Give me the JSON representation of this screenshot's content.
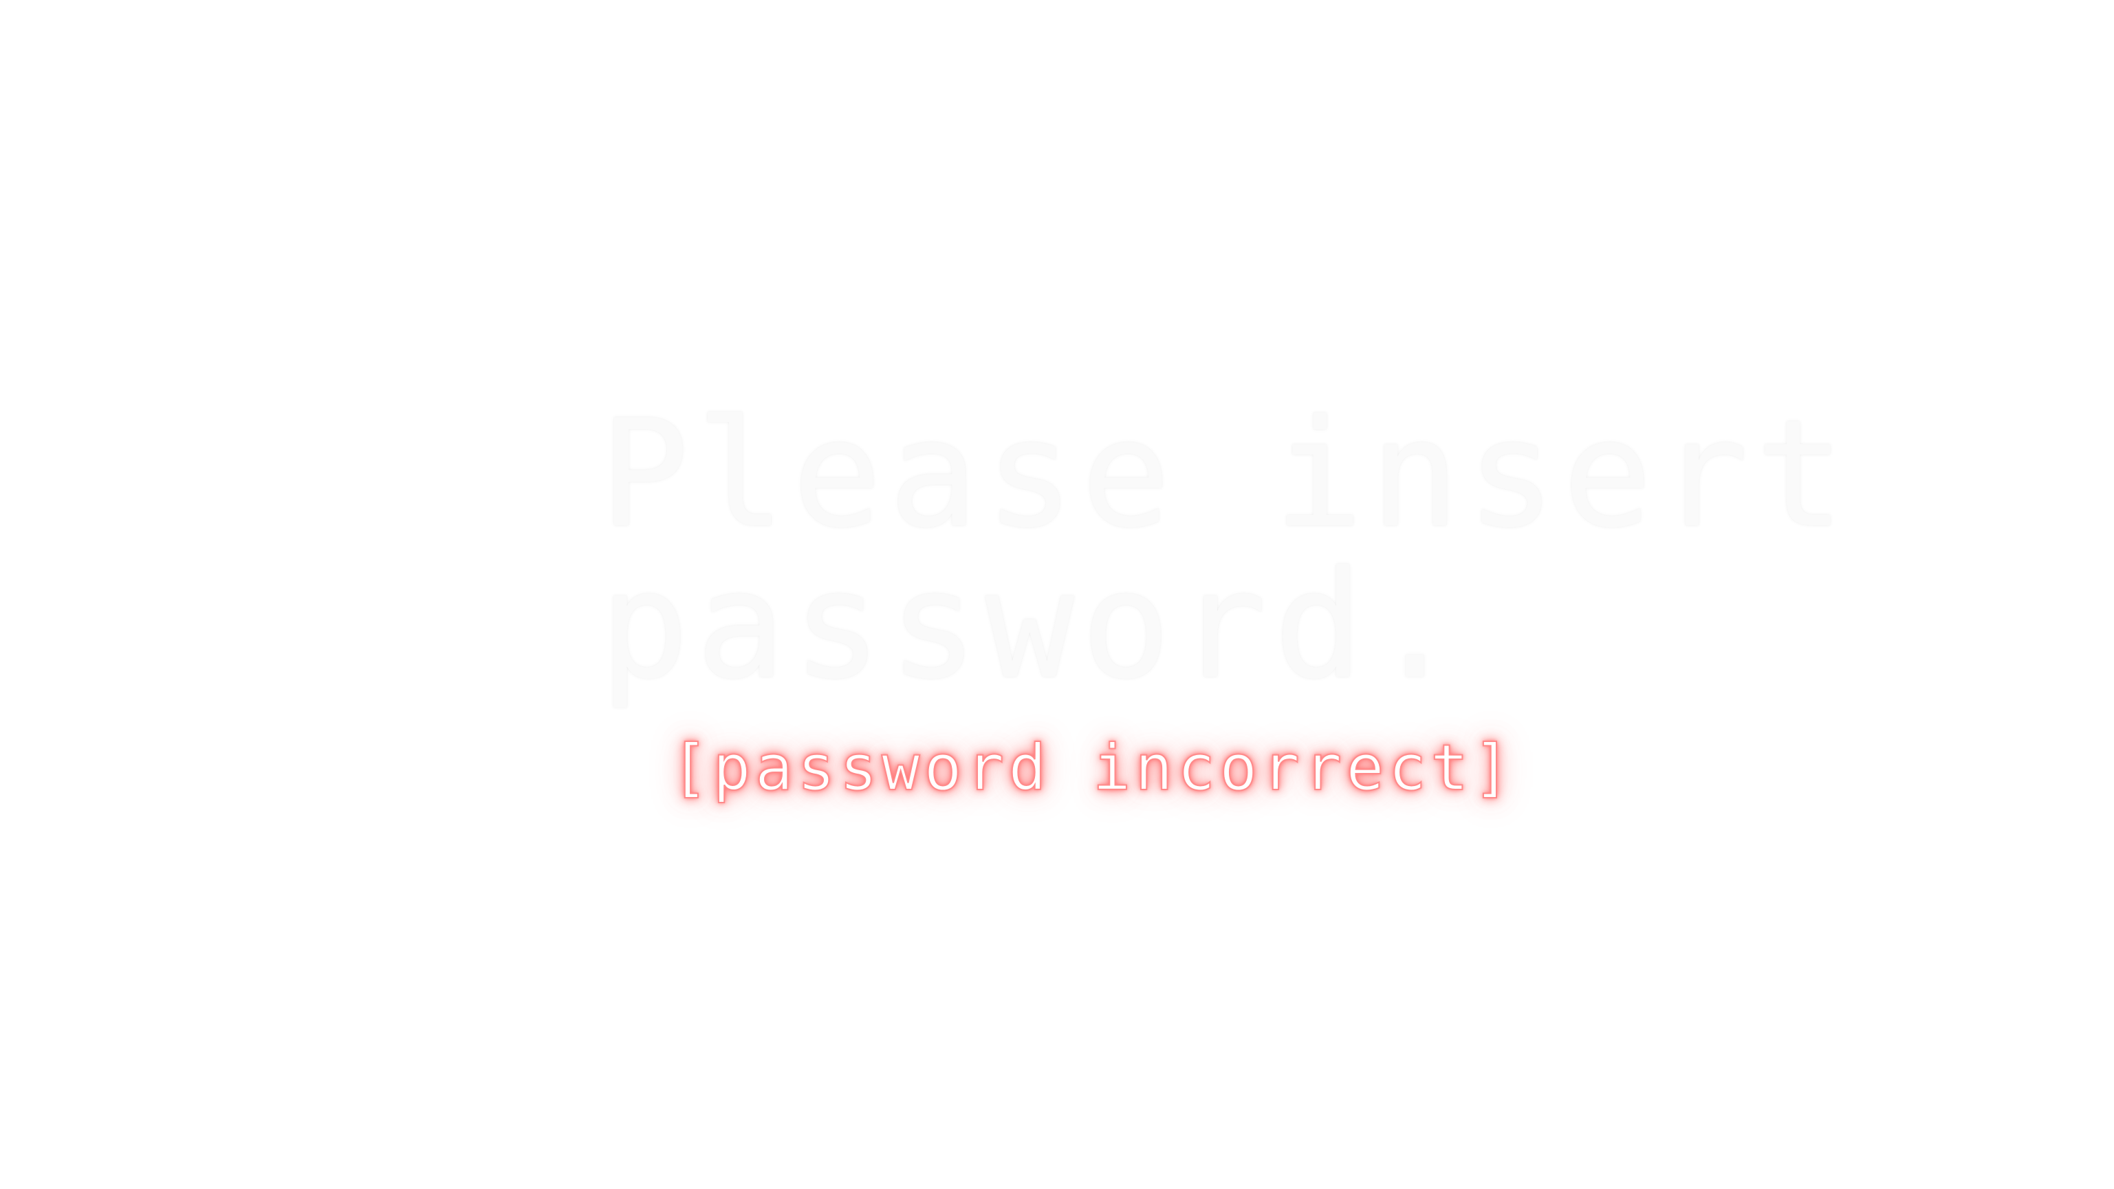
{
  "prompt": {
    "line1": "Please insert",
    "line2": "password."
  },
  "error": {
    "message": "[password incorrect]"
  },
  "colors": {
    "background": "#ffffff",
    "prompt_text": "#fafafa",
    "error_glow": "#ff6b6b"
  }
}
